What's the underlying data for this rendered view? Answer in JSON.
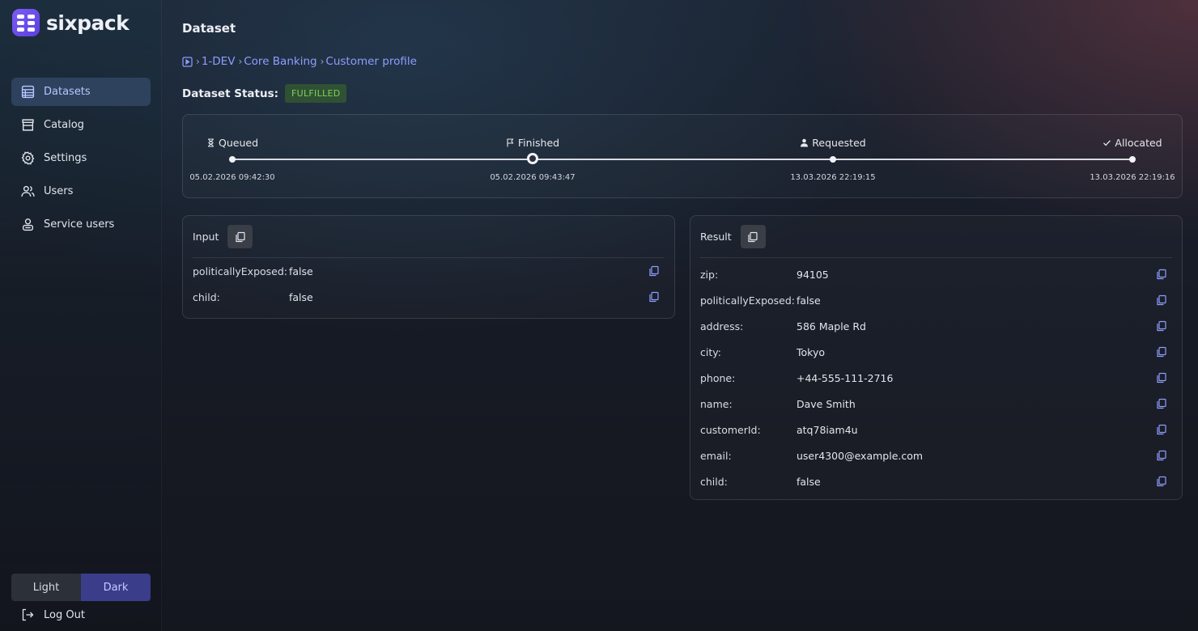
{
  "app": {
    "name": "sixpack",
    "accent": "#6a4ff0"
  },
  "sidebar": {
    "items": [
      {
        "label": "Datasets",
        "icon": "datasets-icon",
        "active": true
      },
      {
        "label": "Catalog",
        "icon": "store-icon",
        "active": false
      },
      {
        "label": "Settings",
        "icon": "gear-icon",
        "active": false
      },
      {
        "label": "Users",
        "icon": "users-icon",
        "active": false
      },
      {
        "label": "Service users",
        "icon": "service-users-icon",
        "active": false
      }
    ],
    "theme": {
      "light": "Light",
      "dark": "Dark",
      "selected": "Dark"
    },
    "logout": "Log Out"
  },
  "page": {
    "title": "Dataset",
    "breadcrumb": [
      "1-DEV",
      "Core Banking",
      "Customer profile"
    ],
    "status_label": "Dataset Status:",
    "status_value": "FULFILLED",
    "status_color": "#7fd05a"
  },
  "timeline": [
    {
      "label": "Queued",
      "icon": "hourglass-icon",
      "date": "05.02.2026 09:42:30"
    },
    {
      "label": "Finished",
      "icon": "flag-icon",
      "date": "05.02.2026 09:43:47",
      "current": true
    },
    {
      "label": "Requested",
      "icon": "person-icon",
      "date": "13.03.2026 22:19:15"
    },
    {
      "label": "Allocated",
      "icon": "check-icon",
      "date": "13.03.2026 22:19:16"
    }
  ],
  "input": {
    "title": "Input",
    "rows": [
      {
        "key": "politicallyExposed:",
        "value": "false"
      },
      {
        "key": "child:",
        "value": "false"
      }
    ]
  },
  "result": {
    "title": "Result",
    "rows": [
      {
        "key": "zip:",
        "value": "94105"
      },
      {
        "key": "politicallyExposed:",
        "value": "false"
      },
      {
        "key": "address:",
        "value": "586 Maple Rd"
      },
      {
        "key": "city:",
        "value": "Tokyo"
      },
      {
        "key": "phone:",
        "value": "+44-555-111-2716"
      },
      {
        "key": "name:",
        "value": "Dave Smith"
      },
      {
        "key": "customerId:",
        "value": "atq78iam4u"
      },
      {
        "key": "email:",
        "value": "user4300@example.com"
      },
      {
        "key": "child:",
        "value": "false"
      }
    ]
  }
}
